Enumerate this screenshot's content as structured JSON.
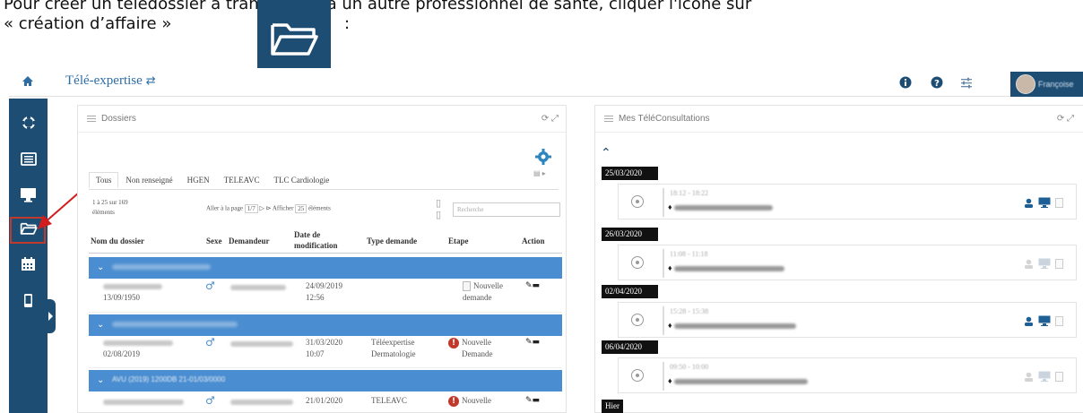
{
  "doc": {
    "line1": "Pour créer un télédossier à transmettre à un autre professionnel de santé, cliquer l'icône sur",
    "line2": "« création d’affaire »",
    "colon": ":"
  },
  "topbar": {
    "title": "Télé-expertise",
    "swap_icon": "⇄",
    "icons": [
      "info-icon",
      "help-icon",
      "settings-sliders-icon"
    ],
    "user_name": "Françoise"
  },
  "sidebar": {
    "items": [
      "sync-icon",
      "list-icon",
      "monitor-icon",
      "folder-open-icon",
      "calendar-icon",
      "mobile-icon"
    ],
    "active": "folder-open-icon",
    "highlight_color": "#c0392b"
  },
  "dossiers": {
    "title": "Dossiers",
    "tabs": [
      "Tous",
      "Non renseigné",
      "HGEN",
      "TELEAVC",
      "TLC Cardiologie"
    ],
    "active_tab": "Tous",
    "count_text": "1 à 25 sur 169",
    "count_suffix": "éléments",
    "goto_label": "Aller à la page",
    "page_value": "1/7",
    "show_label": "Afficher",
    "show_value": "25",
    "show_suffix": "éléments",
    "search_placeholder": "Recherche",
    "columns": [
      "Nom du dossier",
      "Sexe",
      "Demandeur",
      "Date de modification",
      "Type demande",
      "Etape",
      "Action"
    ],
    "rows": [
      {
        "group": "",
        "name_date": "13/09/1950",
        "sex": "♂",
        "modified_date": "24/09/2019",
        "modified_time": "12:56",
        "type1": "",
        "type2": "",
        "etape1": "Nouvelle",
        "etape2": "demande",
        "etape_icon": "document-icon"
      },
      {
        "group": "",
        "name_date": "02/08/2019",
        "sex": "♂",
        "modified_date": "31/03/2020",
        "modified_time": "10:07",
        "type1": "Téléexpertise",
        "type2": "Dermatologie",
        "etape1": "Nouvelle",
        "etape2": "Demande",
        "etape_icon": "alert-icon"
      },
      {
        "group": "AVU (2019) 1200DB 21-01/03/0000",
        "name_date": "",
        "sex": "♂",
        "modified_date": "21/01/2020",
        "modified_time": "",
        "type1": "TELEAVC",
        "type2": "",
        "etape1": "Nouvelle",
        "etape2": "",
        "etape_icon": "alert-icon"
      }
    ]
  },
  "teleconsultations": {
    "title": "Mes TéléConsultations",
    "entries": [
      {
        "date": "25/03/2020",
        "time": "18:12 - 18:22",
        "active": true
      },
      {
        "date": "26/03/2020",
        "time": "11:08 - 11:18",
        "active": false
      },
      {
        "date": "02/04/2020",
        "time": "15:28 - 15:38",
        "active": true
      },
      {
        "date": "06/04/2020",
        "time": "09:50 - 10:00",
        "active": false
      },
      {
        "date": "Hier",
        "time": "",
        "active": false
      }
    ]
  },
  "colors": {
    "navy": "#1e4d73",
    "row_blue": "#4a8dd0",
    "link_blue": "#2e6da4",
    "alert_red": "#c0392b"
  }
}
